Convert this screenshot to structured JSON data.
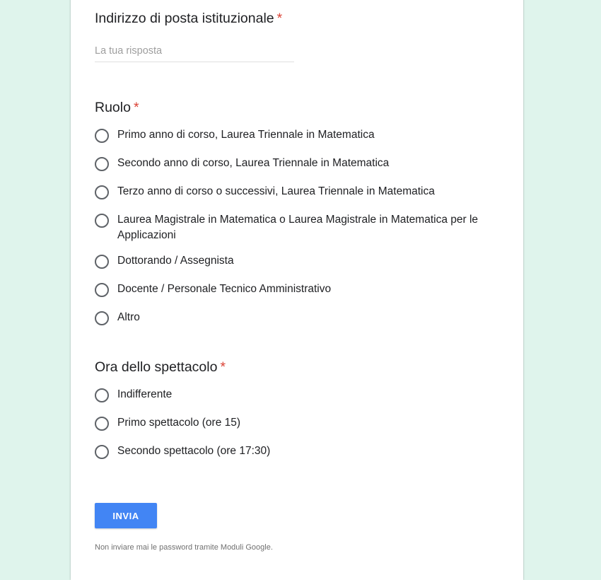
{
  "colors": {
    "page_background": "#dff4ec",
    "card_background": "#ffffff",
    "required_marker": "#db4437",
    "submit_button": "#4285f4"
  },
  "questions": [
    {
      "title": "Indirizzo di posta istituzionale",
      "required_marker": "*",
      "placeholder": "La tua risposta"
    },
    {
      "title": "Ruolo",
      "required_marker": "*",
      "options": [
        "Primo anno di corso, Laurea Triennale in Matematica",
        "Secondo anno di corso, Laurea Triennale in Matematica",
        "Terzo anno di corso o successivi, Laurea Triennale in Matematica",
        "Laurea Magistrale in Matematica o Laurea Magistrale in Matematica per le Applicazioni",
        "Dottorando / Assegnista",
        "Docente / Personale Tecnico Amministrativo",
        "Altro"
      ]
    },
    {
      "title": "Ora dello spettacolo",
      "required_marker": "*",
      "options": [
        "Indifferente",
        "Primo spettacolo (ore 15)",
        "Secondo spettacolo (ore 17:30)"
      ]
    }
  ],
  "submit_label": "INVIA",
  "footer_note": "Non inviare mai le password tramite Moduli Google."
}
